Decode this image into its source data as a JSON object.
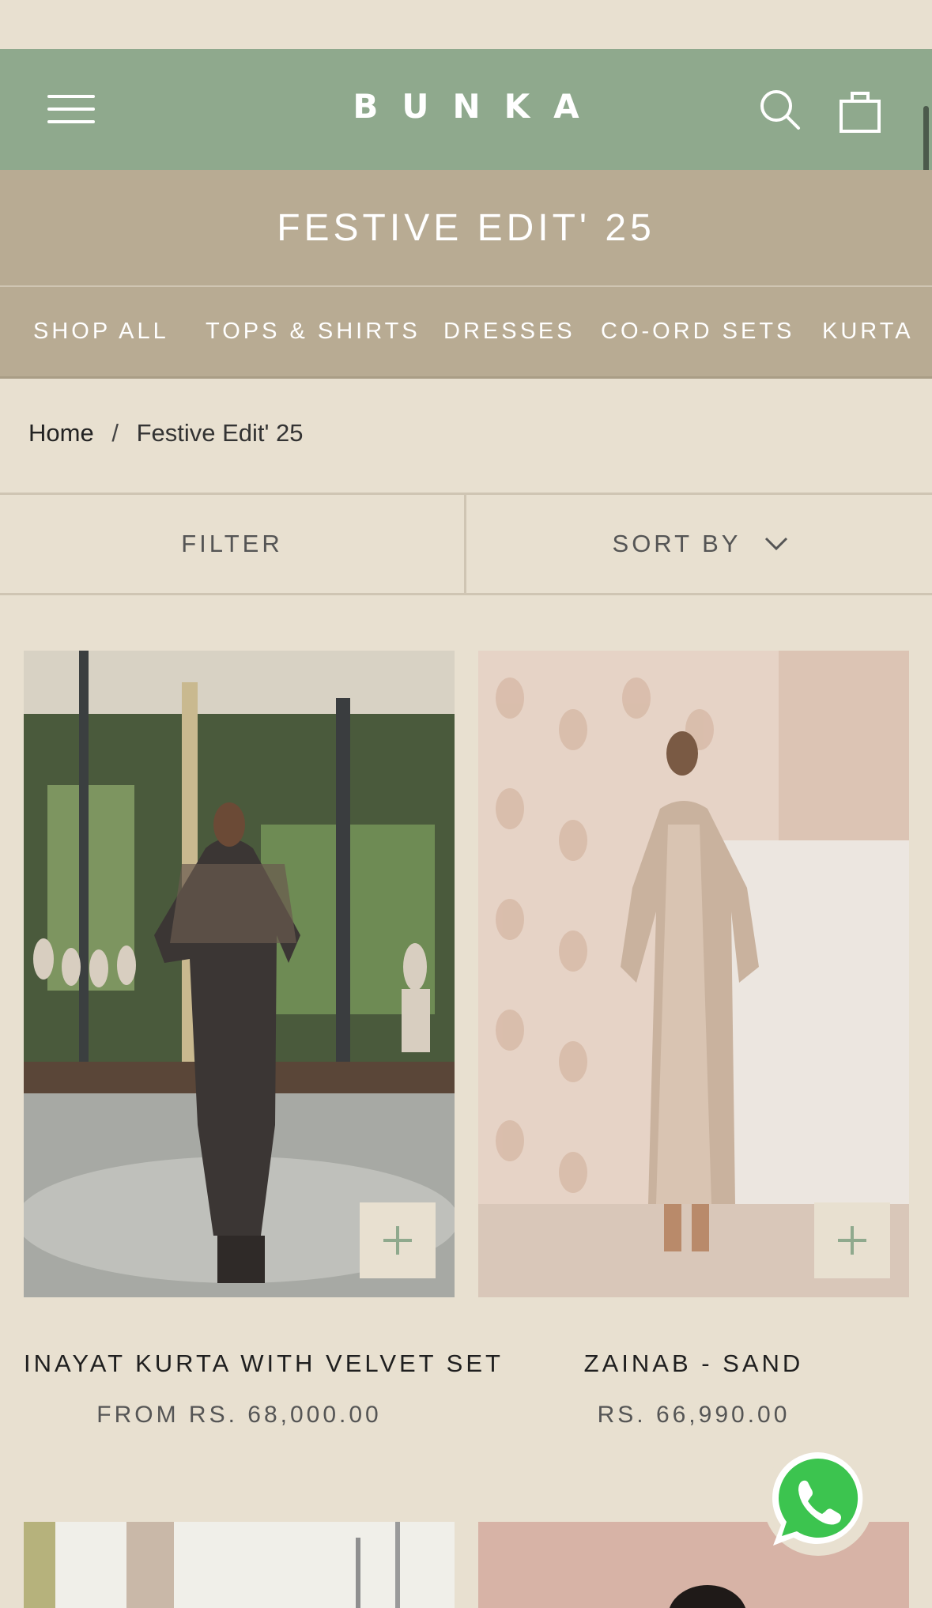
{
  "header": {
    "logo": "BUNKA",
    "menu_icon": "hamburger-menu-icon",
    "search_icon": "search-icon",
    "cart_icon": "shopping-bag-icon",
    "bg_color": "#8fa98d"
  },
  "banner": {
    "title": "FESTIVE EDIT' 25",
    "bg_color": "#b8ab93"
  },
  "category_nav": {
    "items": [
      {
        "label": "SHOP ALL"
      },
      {
        "label": "TOPS & SHIRTS"
      },
      {
        "label": "DRESSES"
      },
      {
        "label": "CO-ORD SETS"
      },
      {
        "label": "KURTA"
      }
    ]
  },
  "breadcrumb": {
    "home": "Home",
    "separator": "/",
    "current": "Festive Edit' 25"
  },
  "toolbar": {
    "filter_label": "FILTER",
    "sort_label": "SORT BY"
  },
  "products": [
    {
      "title": "INAYAT KURTA WITH VELVET SET",
      "price": "FROM RS. 68,000.00"
    },
    {
      "title": "ZAINAB - SAND",
      "price": "RS. 66,990.00"
    }
  ],
  "floating": {
    "whatsapp_icon": "whatsapp-icon",
    "whatsapp_color": "#3cc44f"
  }
}
